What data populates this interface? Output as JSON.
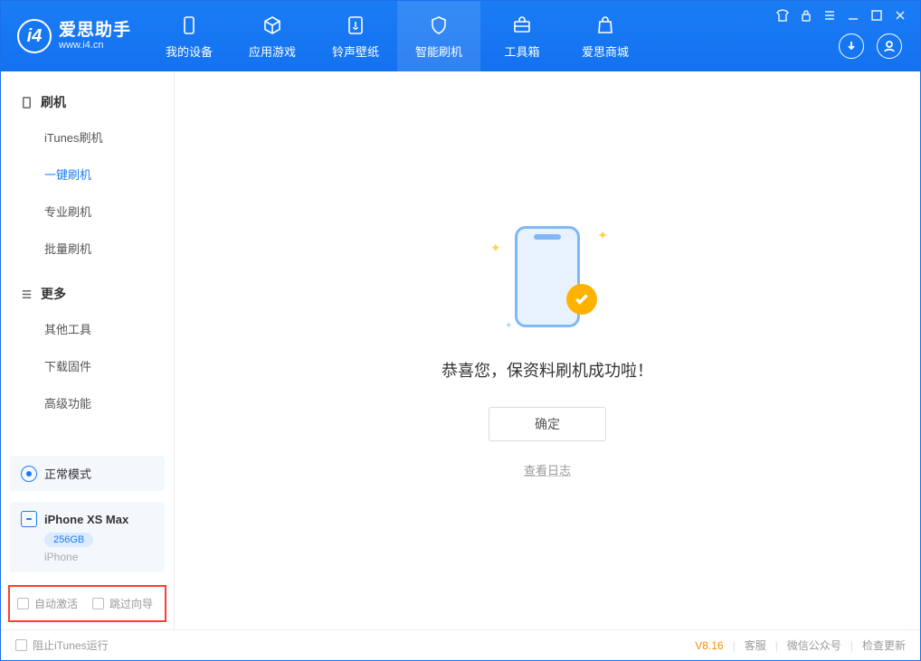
{
  "app": {
    "title": "爱思助手",
    "subtitle": "www.i4.cn"
  },
  "nav": {
    "tabs": [
      {
        "label": "我的设备",
        "icon": "device-icon"
      },
      {
        "label": "应用游戏",
        "icon": "cube-icon"
      },
      {
        "label": "铃声壁纸",
        "icon": "music-icon"
      },
      {
        "label": "智能刷机",
        "icon": "shield-icon",
        "active": true
      },
      {
        "label": "工具箱",
        "icon": "toolbox-icon"
      },
      {
        "label": "爱思商城",
        "icon": "bag-icon"
      }
    ]
  },
  "sidebar": {
    "group1": {
      "title": "刷机",
      "items": [
        "iTunes刷机",
        "一键刷机",
        "专业刷机",
        "批量刷机"
      ],
      "activeIndex": 1
    },
    "group2": {
      "title": "更多",
      "items": [
        "其他工具",
        "下载固件",
        "高级功能"
      ]
    },
    "mode": "正常模式",
    "device": {
      "name": "iPhone XS Max",
      "capacity": "256GB",
      "type": "iPhone"
    },
    "bottom": {
      "cb1": "自动激活",
      "cb2": "跳过向导"
    }
  },
  "main": {
    "success_text": "恭喜您，保资料刷机成功啦！",
    "ok_button": "确定",
    "view_log": "查看日志"
  },
  "footer": {
    "block_itunes": "阻止iTunes运行",
    "version": "V8.16",
    "links": [
      "客服",
      "微信公众号",
      "检查更新"
    ]
  }
}
